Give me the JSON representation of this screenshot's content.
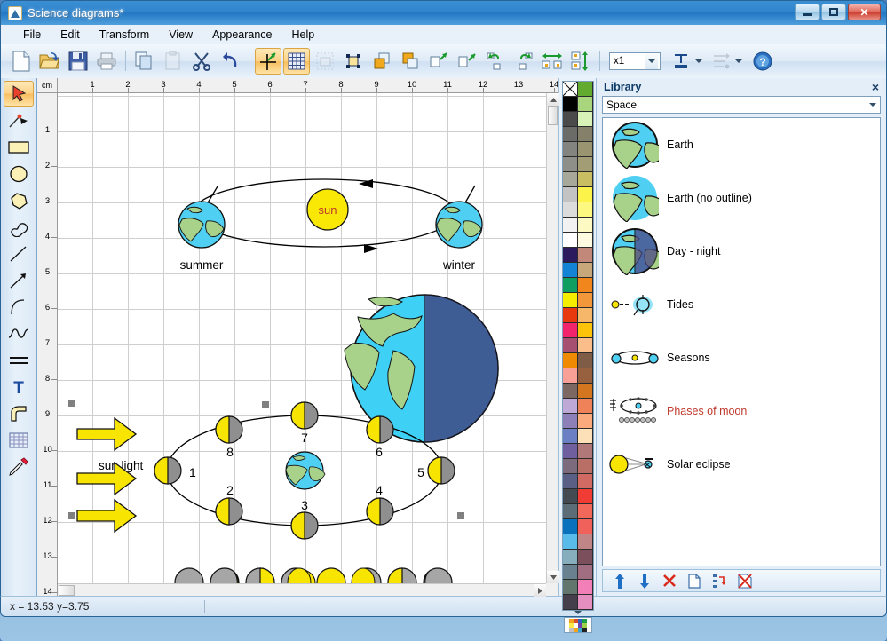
{
  "window": {
    "title": "Science diagrams*",
    "controls": {
      "minimize": "Minimize",
      "maximize": "Maximize",
      "close": "Close"
    }
  },
  "menubar": {
    "items": [
      "File",
      "Edit",
      "Transform",
      "View",
      "Appearance",
      "Help"
    ]
  },
  "toolbar": {
    "buttons": [
      {
        "name": "new-document",
        "icon": "new-file-icon",
        "state": "normal"
      },
      {
        "name": "open",
        "icon": "open-folder-icon",
        "state": "normal"
      },
      {
        "name": "save",
        "icon": "floppy-save-icon",
        "state": "normal"
      },
      {
        "name": "print",
        "icon": "printer-icon",
        "state": "normal"
      },
      {
        "name": "copy",
        "icon": "copy-icon",
        "state": "normal"
      },
      {
        "name": "paste",
        "icon": "paste-icon",
        "state": "normal"
      },
      {
        "name": "cut",
        "icon": "scissors-icon",
        "state": "normal"
      },
      {
        "name": "undo",
        "icon": "undo-arrow-icon",
        "state": "normal"
      },
      {
        "name": "snap-to-point",
        "icon": "snap-crosshair-icon",
        "state": "active"
      },
      {
        "name": "show-grid",
        "icon": "grid-icon",
        "state": "active"
      },
      {
        "name": "select-area",
        "icon": "select-area-icon",
        "state": "disabled"
      },
      {
        "name": "group",
        "icon": "group-handles-icon",
        "state": "normal"
      },
      {
        "name": "bring-to-front",
        "icon": "bring-front-icon",
        "state": "normal"
      },
      {
        "name": "send-to-back",
        "icon": "send-back-icon",
        "state": "normal"
      },
      {
        "name": "flip-horizontal",
        "icon": "flip-horizontal-icon",
        "state": "normal"
      },
      {
        "name": "flip-vertical",
        "icon": "flip-vertical-icon",
        "state": "normal"
      },
      {
        "name": "rotate-left",
        "icon": "rotate-left-icon",
        "state": "normal"
      },
      {
        "name": "rotate-right",
        "icon": "rotate-right-icon",
        "state": "normal"
      },
      {
        "name": "align-horizontal",
        "icon": "align-horizontal-icon",
        "state": "normal"
      },
      {
        "name": "align-vertical",
        "icon": "align-vertical-icon",
        "state": "normal"
      }
    ],
    "zoom": {
      "value": "x1",
      "options": [
        "x1"
      ]
    },
    "line_style_label": "line-style-dropdown",
    "arrow_style_label": "arrow-style-dropdown",
    "help_label": "help-icon"
  },
  "tools": {
    "items": [
      {
        "name": "select-tool",
        "icon": "cursor-arrow-icon",
        "active": true
      },
      {
        "name": "point-tool",
        "icon": "pen-point-icon",
        "active": false
      },
      {
        "name": "rectangle-tool",
        "icon": "rectangle-icon",
        "active": false
      },
      {
        "name": "ellipse-tool",
        "icon": "ellipse-icon",
        "active": false
      },
      {
        "name": "polygon-tool",
        "icon": "polygon-icon",
        "active": false
      },
      {
        "name": "freehand-shape-tool",
        "icon": "freeform-shape-icon",
        "active": false
      },
      {
        "name": "line-tool",
        "icon": "line-icon",
        "active": false
      },
      {
        "name": "arrow-tool",
        "icon": "arrow-line-icon",
        "active": false
      },
      {
        "name": "curve-tool",
        "icon": "curve-icon",
        "active": false
      },
      {
        "name": "wave-tool",
        "icon": "wave-icon",
        "active": false
      },
      {
        "name": "double-line-tool",
        "icon": "double-line-icon",
        "active": false
      },
      {
        "name": "text-tool",
        "icon": "text-t-icon",
        "active": false
      },
      {
        "name": "fill-curve-tool",
        "icon": "filled-curve-icon",
        "active": false
      },
      {
        "name": "grid-tool",
        "icon": "grid-table-icon",
        "active": false
      },
      {
        "name": "eyedropper-tool",
        "icon": "eyedropper-icon",
        "active": false
      }
    ]
  },
  "rulers": {
    "unit": "cm",
    "horizontal_ticks": [
      "1",
      "2",
      "3",
      "4",
      "5",
      "6",
      "7",
      "8",
      "9",
      "10",
      "11",
      "12",
      "13",
      "14"
    ],
    "vertical_ticks": [
      "1",
      "2",
      "3",
      "4",
      "5",
      "6",
      "7",
      "8",
      "9",
      "10",
      "11",
      "12",
      "13",
      "14"
    ]
  },
  "canvas": {
    "seasons": {
      "sun_label": "sun",
      "left_label": "summer",
      "right_label": "winter"
    },
    "sunlight_label": "sun light",
    "moon_numbers": [
      "1",
      "2",
      "3",
      "4",
      "5",
      "6",
      "7",
      "8"
    ]
  },
  "palette": {
    "column_left": [
      "#ffffff",
      "#000000",
      "#4a4a4a",
      "#6b6b68",
      "#838380",
      "#8f8f8a",
      "#a8a89a",
      "#c3c3c3",
      "#dcdcdc",
      "#f2f2f2",
      "#ffffff",
      "#2b1b5e",
      "#1383d6",
      "#0e9e62",
      "#f5ee00",
      "#e8380d",
      "#f2246b",
      "#a74f70",
      "#f08a00",
      "#f9a096",
      "#7d6762",
      "#bda8d6",
      "#8d7fb8",
      "#6b7fc4",
      "#6f5f9e",
      "#7c6b7d",
      "#5a5f86",
      "#444a52",
      "#5c6d78",
      "#0a72bd",
      "#59bbea",
      "#86aebd",
      "#6a8290",
      "#63766e",
      "#453f4b"
    ],
    "column_right": [
      "#63ab2e",
      "#a9d67c",
      "#d9f2b7",
      "#85806a",
      "#9a9470",
      "#a39d75",
      "#c9be62",
      "#fbf34a",
      "#fdf87f",
      "#fdf9c2",
      "#fdfbe0",
      "#c2897a",
      "#c7a87a",
      "#f1861c",
      "#f2983b",
      "#f7b76a",
      "#fcc30a",
      "#fbbd8a",
      "#7e5c46",
      "#97603e",
      "#d4761f",
      "#f0825a",
      "#fbaa7e",
      "#fde0b8",
      "#b07878",
      "#b96f66",
      "#d16a63",
      "#f03c34",
      "#f2695c",
      "#f1615c",
      "#bf8587",
      "#7b4f5c",
      "#a06e80",
      "#f27fb8",
      "#e58fc0"
    ]
  },
  "library": {
    "title": "Library",
    "close_label": "×",
    "category": "Space",
    "categories": [
      "Space"
    ],
    "items": [
      {
        "name": "Earth",
        "icon": "earth-globe-icon",
        "selected": false
      },
      {
        "name": "Earth (no outline)",
        "icon": "earth-globe-no-outline-icon",
        "selected": false
      },
      {
        "name": "Day - night",
        "icon": "day-night-globe-icon",
        "selected": false
      },
      {
        "name": "Tides",
        "icon": "tides-icon",
        "selected": false
      },
      {
        "name": "Seasons",
        "icon": "seasons-orbit-icon",
        "selected": false
      },
      {
        "name": "Phases of moon",
        "icon": "moon-phases-icon",
        "selected": true
      },
      {
        "name": "Solar eclipse",
        "icon": "solar-eclipse-icon",
        "selected": false
      }
    ],
    "toolbar_buttons": [
      {
        "name": "move-up-button",
        "icon": "arrow-up-icon"
      },
      {
        "name": "move-down-button",
        "icon": "arrow-down-icon"
      },
      {
        "name": "delete-item-button",
        "icon": "red-x-icon"
      },
      {
        "name": "new-item-button",
        "icon": "new-page-icon"
      },
      {
        "name": "update-item-button",
        "icon": "update-item-icon"
      },
      {
        "name": "delete-library-button",
        "icon": "delete-library-icon"
      }
    ]
  },
  "statusbar": {
    "coordinates": "x = 13.53 y=3.75"
  }
}
